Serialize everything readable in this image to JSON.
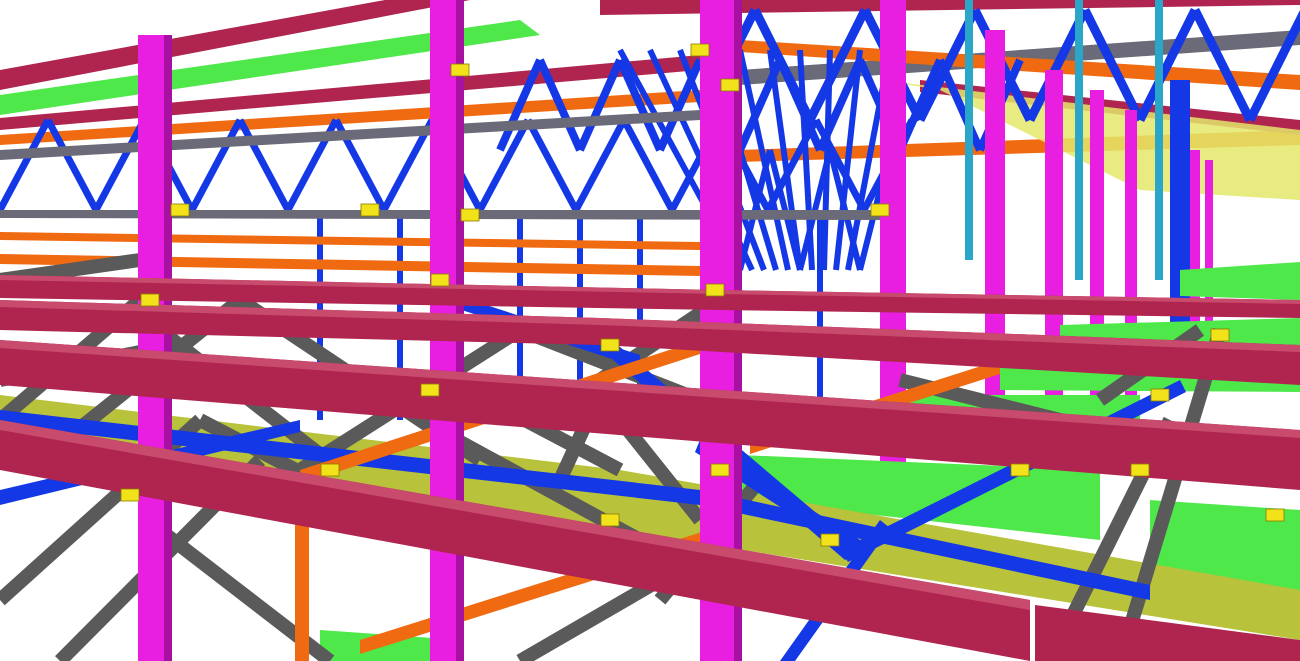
{
  "scene": {
    "kind": "3d-structural-steel-model",
    "background": "#ffffff",
    "palette": {
      "column_magenta": "#e81ee0",
      "column_magenta_dark": "#a810a2",
      "truss_blue": "#1438e6",
      "truss_blue_dark": "#0a1f99",
      "beam_crimson": "#b0254f",
      "beam_crimson_dark": "#7a1535",
      "beam_crimson_top": "#c84a6d",
      "bracing_gray": "#5a5a5a",
      "bracing_gray_dark": "#3a3a3a",
      "beam_orange": "#f06a12",
      "deck_green": "#4ee84a",
      "deck_green_dark": "#2ea82a",
      "deck_olive": "#b8c23a",
      "plate_yellow": "#f2e21a",
      "hanger_cyan": "#2aa6c8",
      "chord_gray": "#6a6a78"
    }
  }
}
